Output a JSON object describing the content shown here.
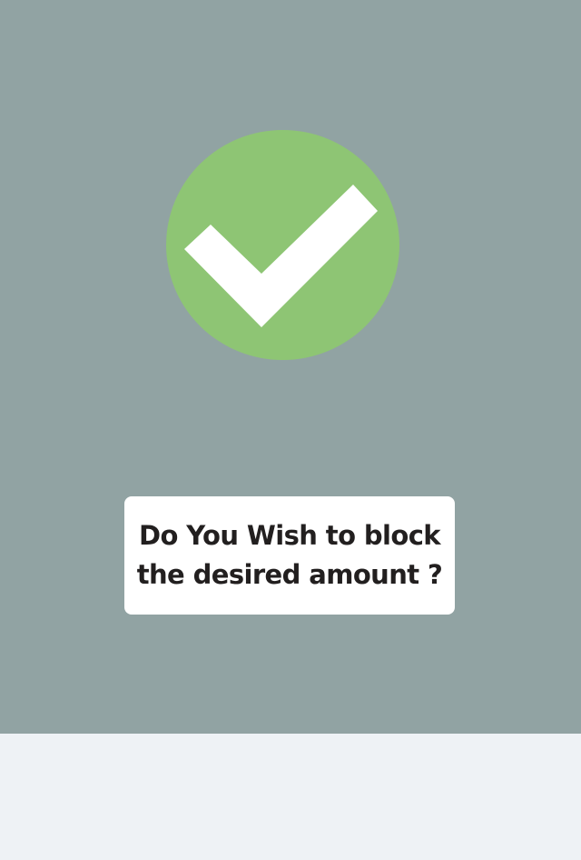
{
  "colors": {
    "panel_background": "#91a3a3",
    "success_green": "#8ec574",
    "check_mark": "#ffffff",
    "card_background": "#ffffff",
    "text_dark": "#221f1f",
    "bottom_background": "#eef2f5"
  },
  "status_icon": {
    "icon": "checkmark-icon",
    "state": "success"
  },
  "prompt": {
    "line1": "Do You Wish to block",
    "line2": "the desired amount ?"
  }
}
